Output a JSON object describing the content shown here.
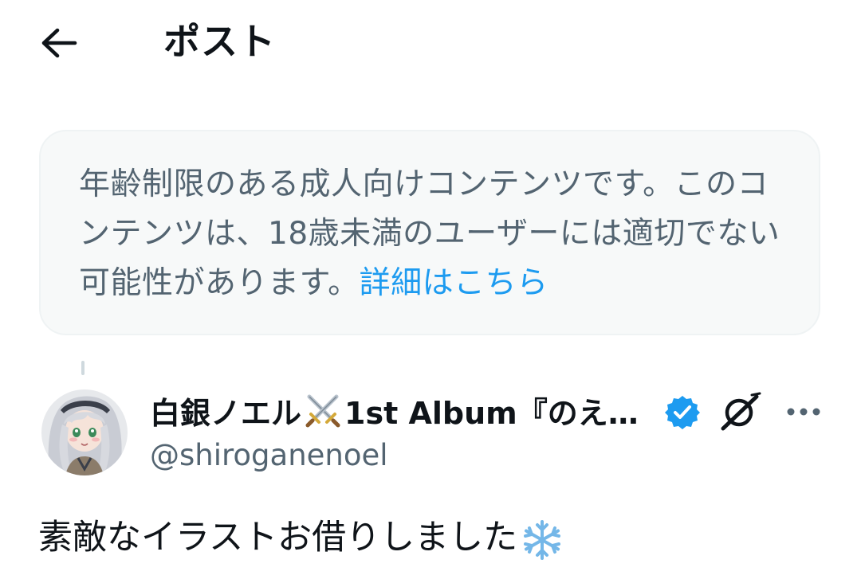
{
  "header": {
    "back_icon": "arrow-left-icon",
    "title": "ポスト"
  },
  "warning": {
    "text": "年齢制限のある成人向けコンテンツです。このコンテンツは、18歳未満のユーザーには適切でない可能性があります。",
    "link_label": "詳細はこちら",
    "link_color": "#1d9bf0",
    "text_color": "#536471",
    "background": "#f7f9f9"
  },
  "author": {
    "display_name": "白銀ノエル",
    "name_emoji": "crossed-swords-icon",
    "name_suffix": "1st Album『のえ…",
    "verified_icon": "verified-badge-icon",
    "verified_color": "#1d9bf0",
    "handle": "@shiroganenoel",
    "grok_icon": "grok-icon",
    "more_icon": "more-dots-icon"
  },
  "post": {
    "text": "素敵なイラストお借りしました",
    "emoji": "snowflake-icon"
  }
}
